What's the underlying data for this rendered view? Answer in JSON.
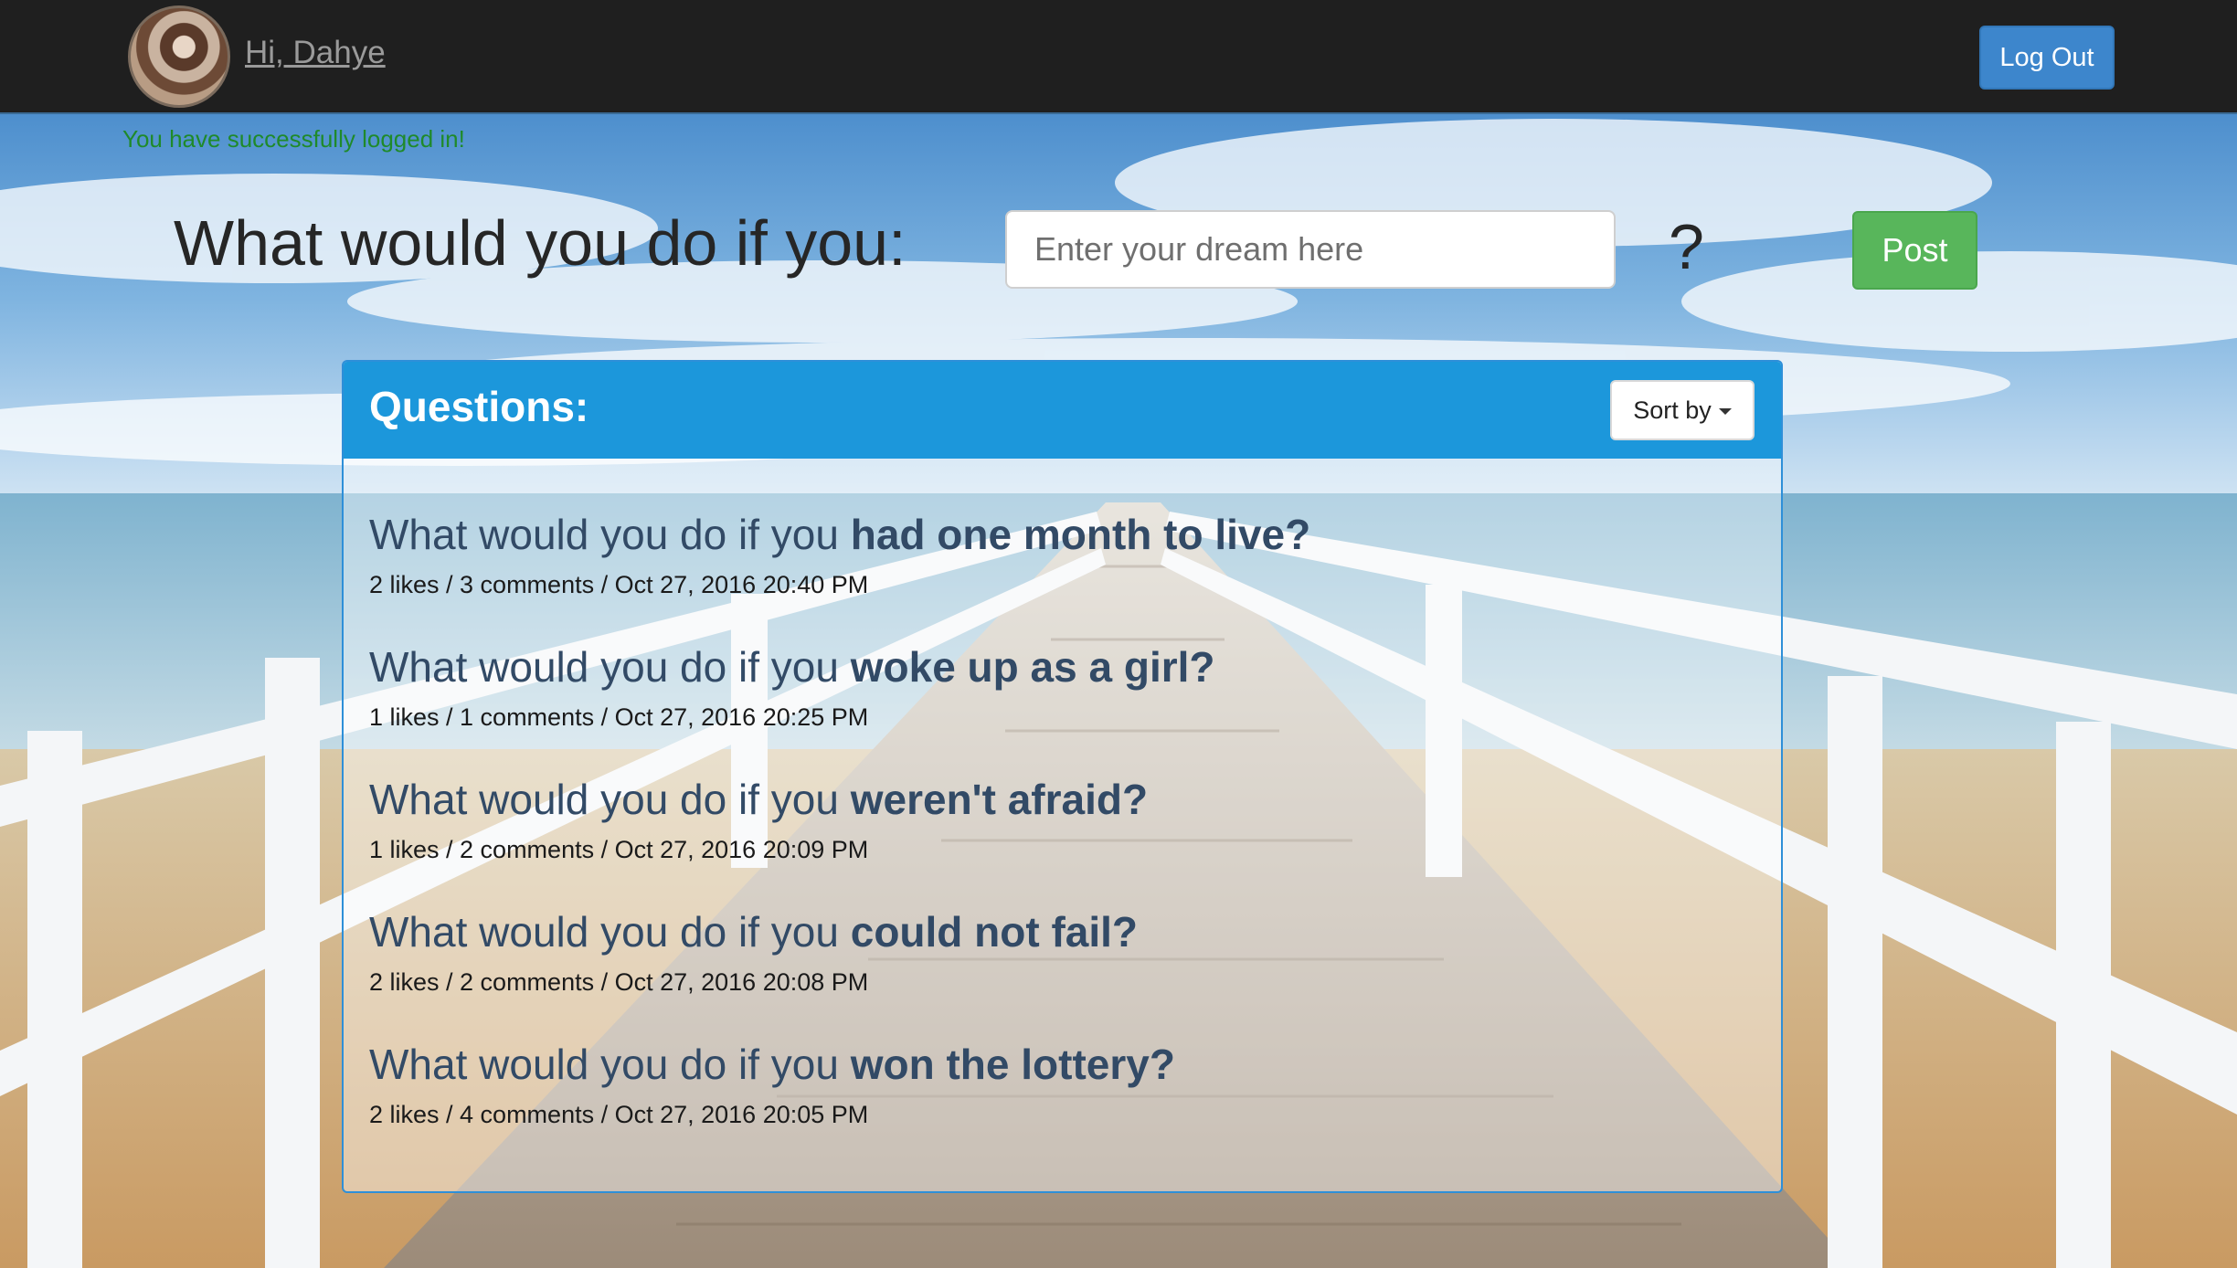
{
  "nav": {
    "greeting": "Hi, Dahye",
    "logout_label": "Log Out"
  },
  "flash_message": "You have successfully logged in!",
  "prompt": {
    "label": "What would you do if you:",
    "placeholder": "Enter your dream here",
    "value": "",
    "suffix": "?",
    "post_label": "Post"
  },
  "questions_panel": {
    "title": "Questions:",
    "sort_label": "Sort by",
    "items": [
      {
        "prefix": "What would you do if you ",
        "rest": "had one month to live?",
        "meta": "2 likes / 3 comments / Oct 27, 2016 20:40 PM"
      },
      {
        "prefix": "What would you do if you ",
        "rest": "woke up as a girl?",
        "meta": "1 likes / 1 comments / Oct 27, 2016 20:25 PM"
      },
      {
        "prefix": "What would you do if you ",
        "rest": "weren't afraid?",
        "meta": "1 likes / 2 comments / Oct 27, 2016 20:09 PM"
      },
      {
        "prefix": "What would you do if you ",
        "rest": "could not fail?",
        "meta": "2 likes / 2 comments / Oct 27, 2016 20:08 PM"
      },
      {
        "prefix": "What would you do if you ",
        "rest": "won the lottery?",
        "meta": "2 likes / 4 comments / Oct 27, 2016 20:05 PM"
      }
    ]
  },
  "colors": {
    "navbar": "#1f1f1f",
    "logout": "#3d86cc",
    "post": "#58b65b",
    "panel_header": "#1c97db",
    "flash": "#1f8a2a",
    "question_title": "#324a66"
  }
}
